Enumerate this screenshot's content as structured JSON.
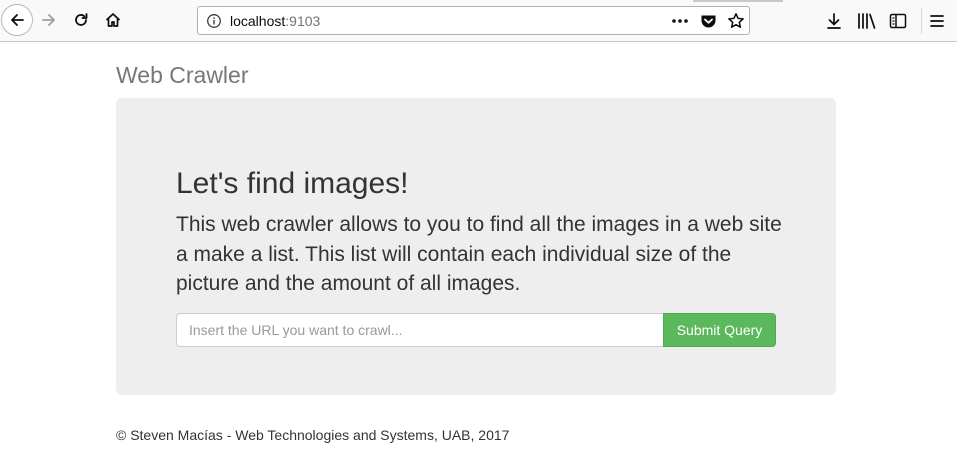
{
  "browser": {
    "url_host": "localhost",
    "url_port": ":9103",
    "icons": {
      "back": "arrow-left-icon",
      "forward": "arrow-right-icon",
      "reload": "reload-icon",
      "home": "home-icon",
      "site_info": "info-icon",
      "page_actions": "more-dots-icon",
      "pocket": "pocket-icon",
      "bookmark": "star-icon",
      "downloads": "download-icon",
      "library": "library-icon",
      "sidebar": "sidebar-icon",
      "menu": "hamburger-menu-icon"
    }
  },
  "page": {
    "brand": "Web Crawler",
    "jumbotron": {
      "title": "Let's find images!",
      "lead": "This web crawler allows to you to find all the images in a web site a make a list. This list will contain each individual size of the picture and the amount of all images."
    },
    "form": {
      "input_placeholder": "Insert the URL you want to crawl...",
      "input_value": "",
      "submit_label": "Submit Query"
    },
    "footer": "© Steven Macías - Web Technologies and Systems, UAB, 2017"
  },
  "colors": {
    "jumbotron_bg": "#eeeeee",
    "submit_bg": "#5cb85c",
    "brand_text": "#777777"
  }
}
